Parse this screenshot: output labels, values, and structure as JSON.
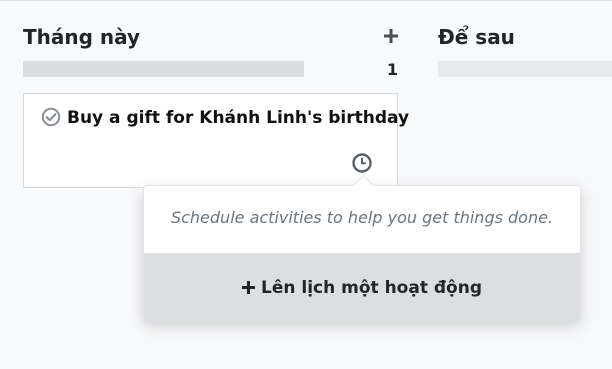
{
  "columns": [
    {
      "title": "Tháng này",
      "count": "1"
    },
    {
      "title": "Để sau"
    }
  ],
  "card": {
    "title": "Buy a gift for Khánh Linh's birthday"
  },
  "popover": {
    "message": "Schedule activities to help you get things done.",
    "button_label": "Lên lịch một hoạt động"
  },
  "icons": {
    "add": "plus-icon",
    "check": "check-circle-icon",
    "clock": "clock-icon"
  },
  "colors": {
    "progress": "#dcdde0",
    "button_bg": "#dddee1",
    "muted_text": "#6c757d"
  }
}
